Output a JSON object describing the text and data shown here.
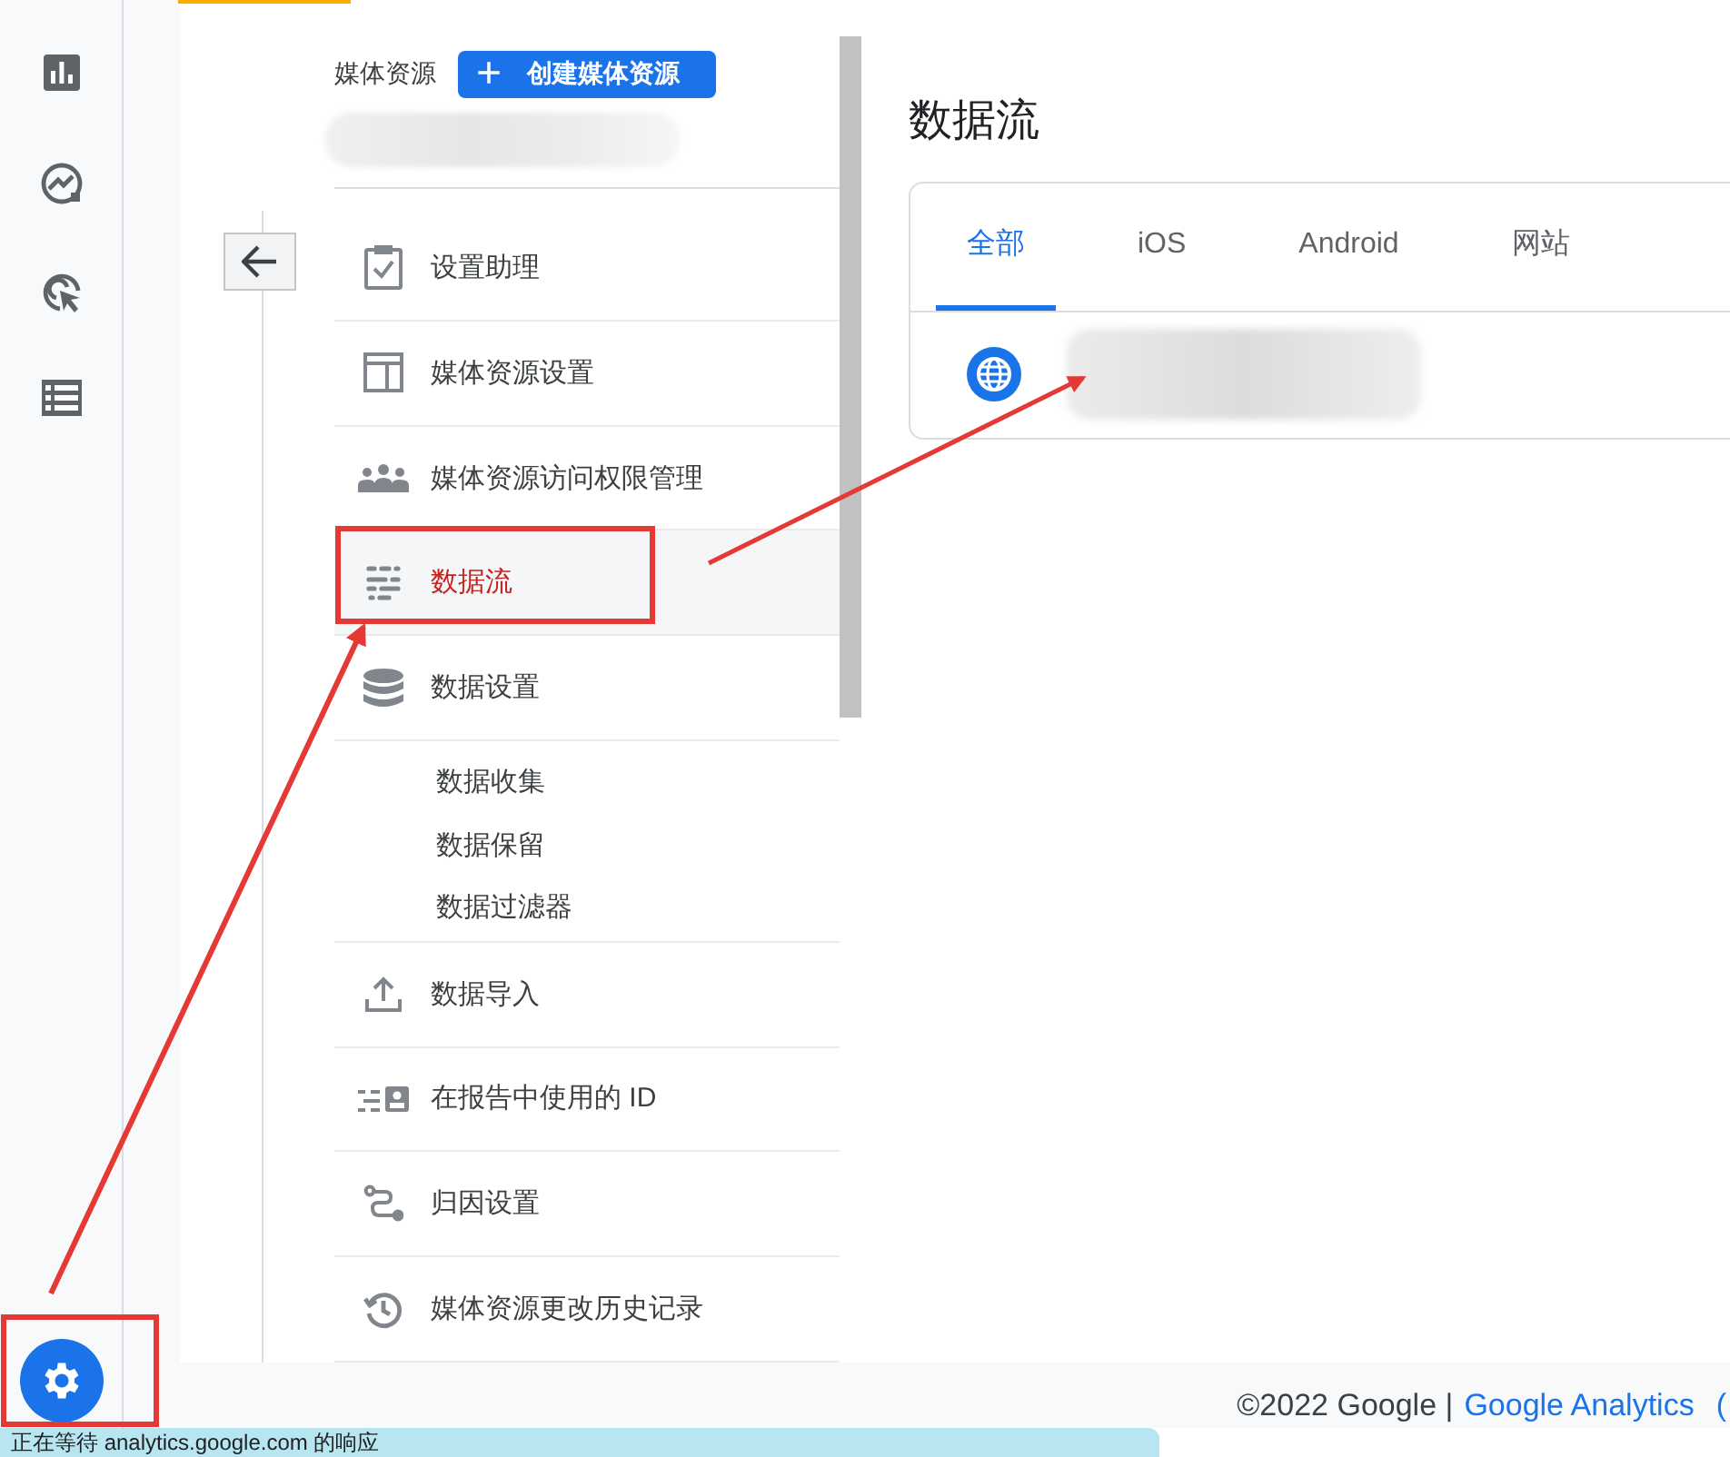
{
  "rail": {
    "items": [
      {
        "selected": false
      },
      {
        "selected": false
      },
      {
        "selected": false
      },
      {
        "selected": false
      }
    ],
    "admin": {
      "selected": true
    }
  },
  "property": {
    "label": "媒体资源",
    "create_button": "创建媒体资源",
    "plus": "+"
  },
  "menu": [
    {
      "kind": "item",
      "label": "设置助理",
      "selected": false
    },
    {
      "kind": "item",
      "label": "媒体资源设置",
      "selected": false
    },
    {
      "kind": "item",
      "label": "媒体资源访问权限管理",
      "selected": false
    },
    {
      "kind": "item",
      "label": "数据流",
      "selected": true
    },
    {
      "kind": "item",
      "label": "数据设置",
      "selected": false
    },
    {
      "kind": "subitem",
      "label": "数据收集",
      "selected": false
    },
    {
      "kind": "subitem",
      "label": "数据保留",
      "selected": false
    },
    {
      "kind": "subitem",
      "label": "数据过滤器",
      "selected": false
    },
    {
      "kind": "item",
      "label": "数据导入",
      "selected": false
    },
    {
      "kind": "item",
      "label": "在报告中使用的 ID",
      "selected": false
    },
    {
      "kind": "item",
      "label": "归因设置",
      "selected": false
    },
    {
      "kind": "item",
      "label": "媒体资源更改历史记录",
      "selected": false
    }
  ],
  "streams": {
    "title": "数据流",
    "tabs": [
      {
        "label": "全部",
        "selected": true
      },
      {
        "label": "iOS",
        "selected": false
      },
      {
        "label": "Android",
        "selected": false
      },
      {
        "label": "网站",
        "selected": false
      }
    ]
  },
  "footer": {
    "copyright": "©2022 Google |",
    "link": "Google Analytics",
    "tail": "("
  },
  "status_bar": "正在等待 analytics.google.com 的响应"
}
